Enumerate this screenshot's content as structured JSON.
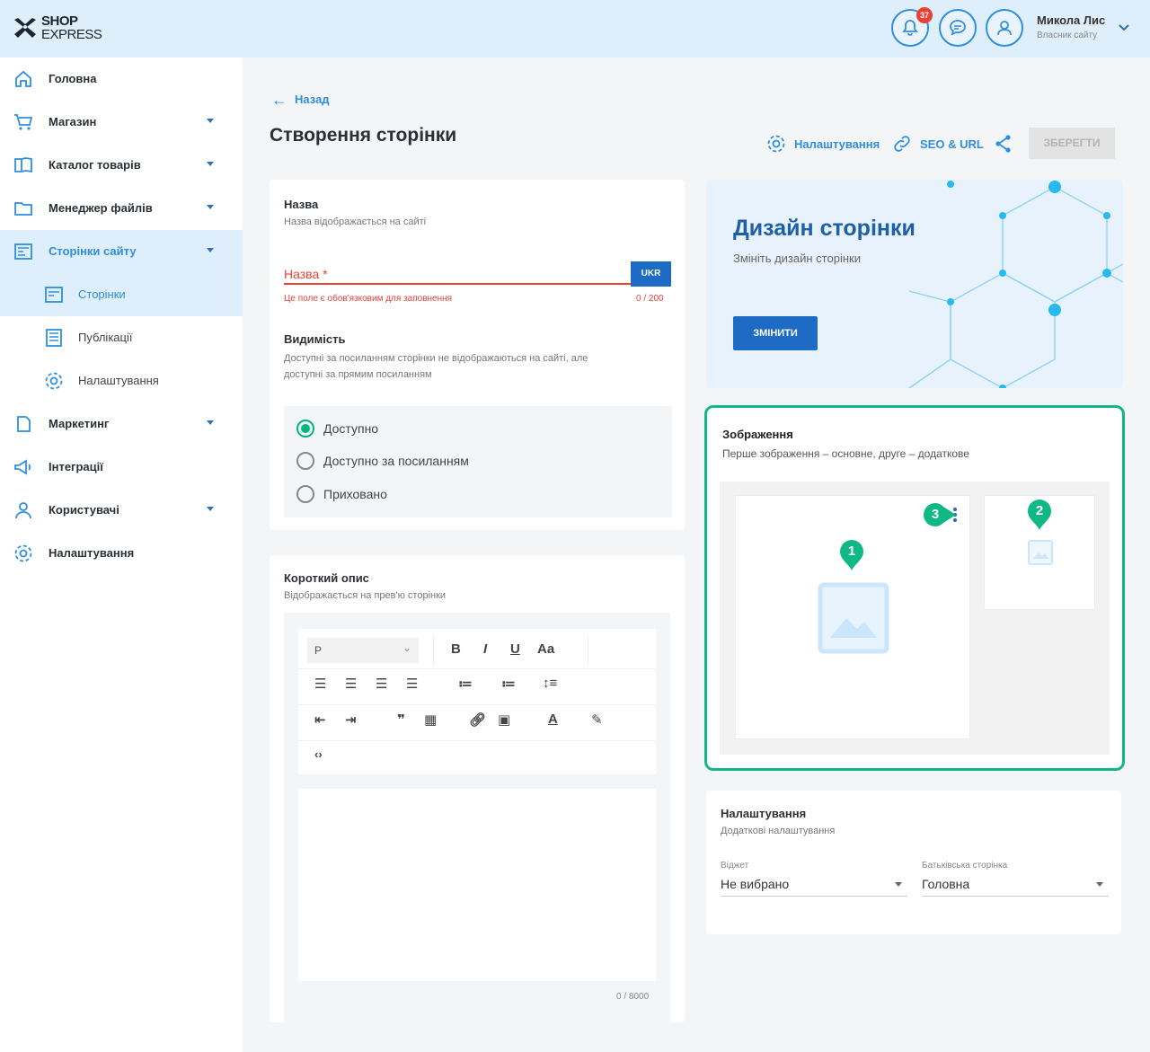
{
  "header": {
    "logo_line1": "SHOP",
    "logo_line2": "EXPRESS",
    "notifications_count": "37",
    "user_name": "Микола Лис",
    "user_role": "Власник сайту",
    "brand_color": "#2f8ee0"
  },
  "sidebar": {
    "items": [
      {
        "label": "Головна",
        "icon": "home-icon"
      },
      {
        "label": "Магазин",
        "icon": "cart-icon"
      },
      {
        "label": "Каталог товарів",
        "icon": "catalog-icon"
      },
      {
        "label": "Менеджер файлів",
        "icon": "folder-icon"
      },
      {
        "label": "Сторінки сайту",
        "icon": "pages-icon"
      },
      {
        "label": "Маркетинг",
        "icon": "marketing-icon"
      },
      {
        "label": "Інтеграції",
        "icon": "megaphone-icon"
      },
      {
        "label": "Користувачі",
        "icon": "user-icon"
      },
      {
        "label": "Налаштування",
        "icon": "gear-icon"
      }
    ],
    "subitems": [
      {
        "label": "Сторінки",
        "icon": "page-icon"
      },
      {
        "label": "Публікації",
        "icon": "publication-icon"
      },
      {
        "label": "Налаштування",
        "icon": "gear-icon"
      }
    ]
  },
  "page": {
    "back_label": "Назад",
    "title": "Створення сторінки",
    "settings_label": "Налаштування",
    "seo_label": "SEO & URL",
    "save_label": "ЗБЕРЕГТИ"
  },
  "name_card": {
    "title": "Назва",
    "subtitle": "Назва відображається на сайті",
    "field_label": "Назва *",
    "lang_button": "UKR",
    "error": "Це поле є обов'язковим для заповнення",
    "counter": "0 / 200",
    "visibility_title": "Видимість",
    "visibility_sub_1": "Доступні за посиланням сторінки не відображаються на сайті, але",
    "visibility_sub_2": "доступні за прямим посиланням",
    "options": [
      "Доступно",
      "Доступно за посиланням",
      "Приховано"
    ],
    "selected_option": "Доступно"
  },
  "desc_card": {
    "title": "Короткий опис",
    "subtitle": "Відображається на прев'ю сторінки",
    "format_value": "P",
    "counter": "0 / 8000"
  },
  "design_card": {
    "title": "Дизайн сторінки",
    "subtitle": "Змініть дизайн сторінки",
    "button": "ЗМІНИТИ"
  },
  "images_card": {
    "title": "Зображення",
    "subtitle": "Перше зображення – основне, друге – додаткове",
    "marker_1": "1",
    "marker_2": "2",
    "marker_3": "3",
    "accent_color": "#10b886"
  },
  "settings_card": {
    "title": "Налаштування",
    "subtitle": "Додаткові налаштування",
    "widget_label": "Віджет",
    "widget_value": "Не вибрано",
    "parent_label": "Батьківська сторінка",
    "parent_value": "Головна"
  }
}
